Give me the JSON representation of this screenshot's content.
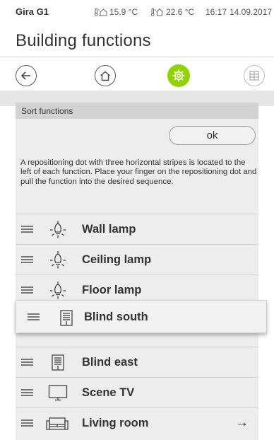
{
  "status_bar": {
    "brand": "Gira G1",
    "outdoor_temp": "15.9 °C",
    "indoor_temp": "22.6 °C",
    "time": "16:17",
    "date": "14.09.2017"
  },
  "page": {
    "title": "Building functions"
  },
  "nav": {
    "back_icon": "arrow-left-icon",
    "home_icon": "home-icon",
    "settings_icon": "settings-gear-icon",
    "grid_icon": "grid-icon",
    "active_color": "#8fd400"
  },
  "sort_panel": {
    "header": "Sort functions",
    "ok_label": "ok",
    "info_text": "A repositioning dot with three horizontal stripes is located to the left of each function. Place your finger on the repositioning dot and pull the function into the desired sequence."
  },
  "functions": [
    {
      "label": "Wall lamp",
      "icon": "lamp-icon"
    },
    {
      "label": "Ceiling lamp",
      "icon": "lamp-icon"
    },
    {
      "label": "Floor lamp",
      "icon": "lamp-icon"
    },
    {
      "label": "Blind east",
      "icon": "blind-icon"
    },
    {
      "label": "Scene TV",
      "icon": "tv-icon"
    },
    {
      "label": "Living room",
      "icon": "sofa-icon",
      "has_arrow": true,
      "arrow": "→"
    }
  ],
  "dragging_item": {
    "label": "Blind south",
    "icon": "blind-icon"
  }
}
